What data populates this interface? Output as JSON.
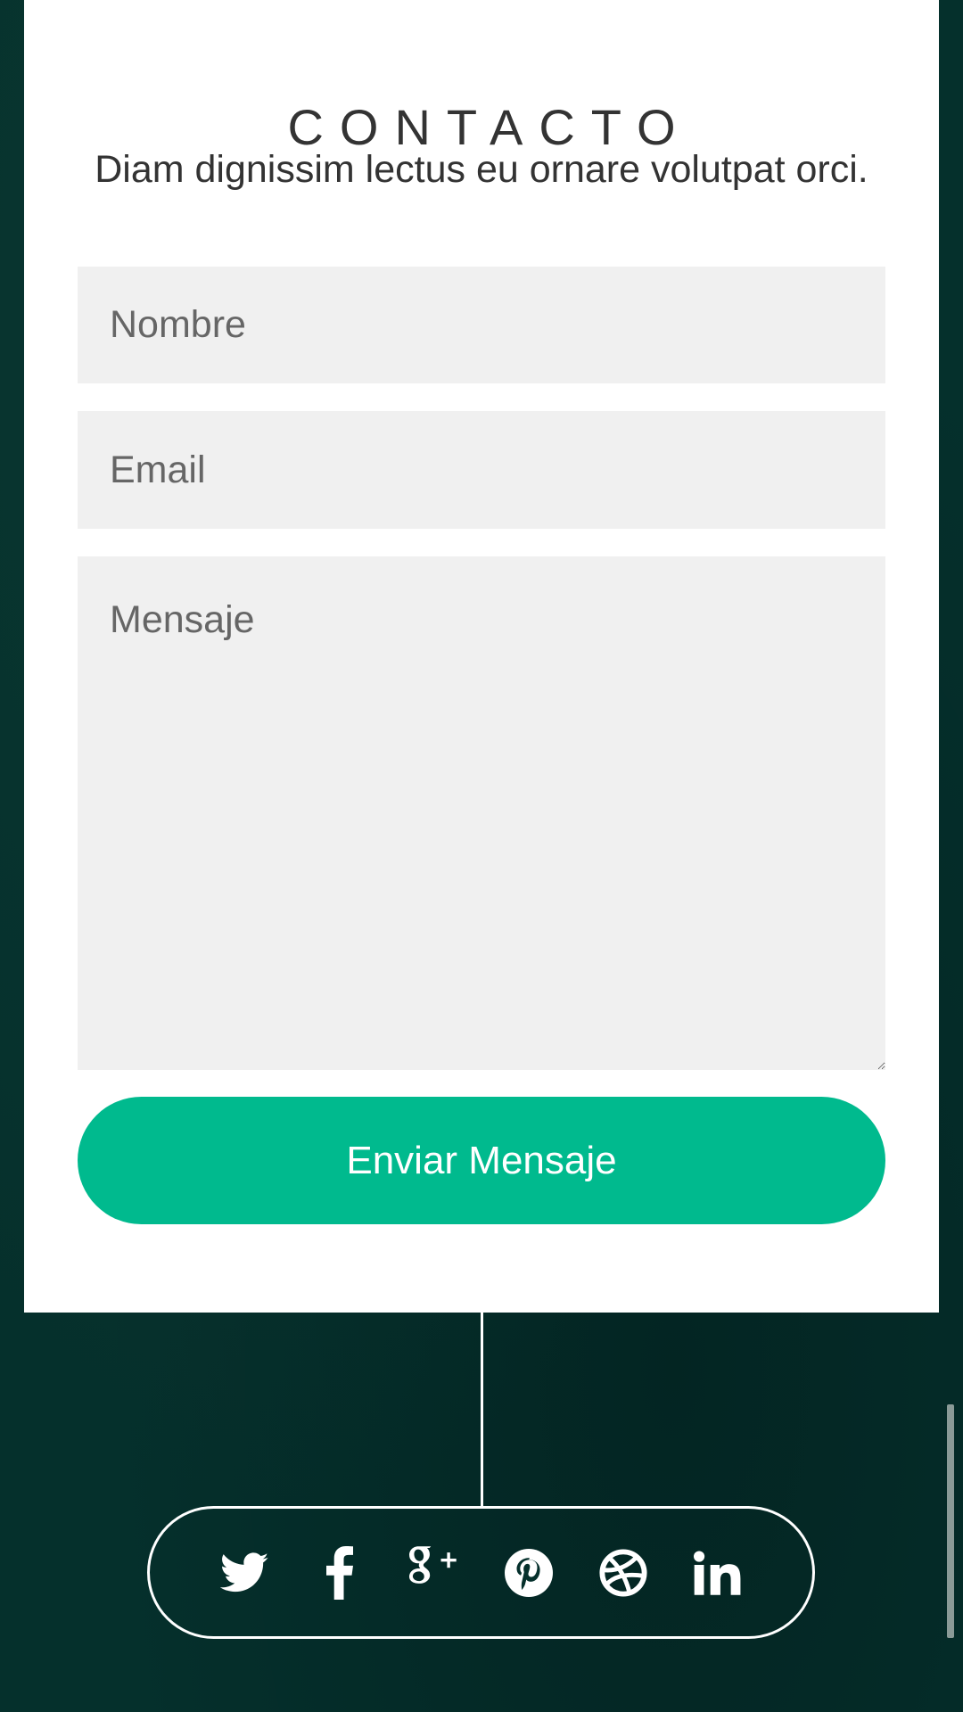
{
  "contact": {
    "title": "CONTACTO",
    "subtitle": "Diam dignissim lectus eu ornare volutpat orci.",
    "name_placeholder": "Nombre",
    "email_placeholder": "Email",
    "message_placeholder": "Mensaje",
    "submit_label": "Enviar Mensaje"
  },
  "social": {
    "icons": [
      "twitter-icon",
      "facebook-icon",
      "google-plus-icon",
      "pinterest-icon",
      "dribbble-icon",
      "linkedin-icon"
    ]
  },
  "colors": {
    "background": "#05302c",
    "card": "#ffffff",
    "accent": "#00ba8e",
    "field_bg": "#f0f0f0",
    "text": "#333333"
  }
}
